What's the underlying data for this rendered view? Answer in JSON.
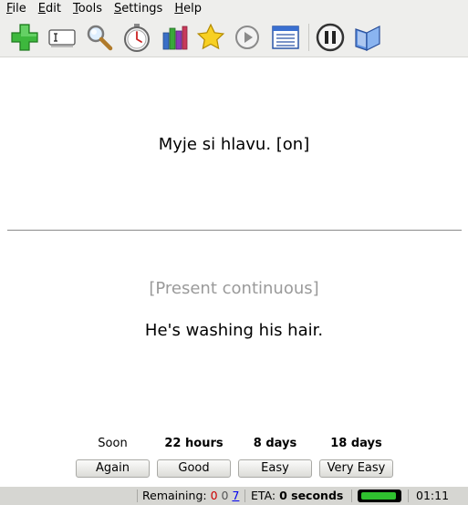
{
  "menubar": {
    "items": [
      {
        "key": "F",
        "rest": "ile"
      },
      {
        "key": "E",
        "rest": "dit"
      },
      {
        "key": "T",
        "rest": "ools"
      },
      {
        "key": "S",
        "rest": "ettings"
      },
      {
        "key": "H",
        "rest": "elp"
      }
    ]
  },
  "toolbar": {
    "icons": [
      "add-icon",
      "edit-card-icon",
      "search-icon",
      "timer-icon",
      "statistics-icon",
      "star-icon",
      "play-icon",
      "card-list-icon",
      "pause-icon",
      "deck-book-icon"
    ]
  },
  "card": {
    "question": "Myje si hlavu. [on]",
    "hint": "[Present continuous]",
    "answer": "He's washing his hair."
  },
  "ease": [
    {
      "time": "Soon",
      "label": "Again"
    },
    {
      "time": "22 hours",
      "label": "Good"
    },
    {
      "time": "8 days",
      "label": "Easy"
    },
    {
      "time": "18 days",
      "label": "Very Easy"
    }
  ],
  "status": {
    "remaining_label": "Remaining:",
    "remaining_failed": "0",
    "remaining_review": "0",
    "remaining_new": "7",
    "eta_label": "ETA:",
    "eta_value": "0 seconds",
    "progress": 0.95,
    "time": "01:11"
  },
  "colors": {
    "toolbar_bg": "#eeeeec",
    "status_bg": "#d6d6d2",
    "progress_fill": "#2fc12f",
    "remaining_failed": "#cc0000",
    "remaining_new": "#0000ee"
  }
}
